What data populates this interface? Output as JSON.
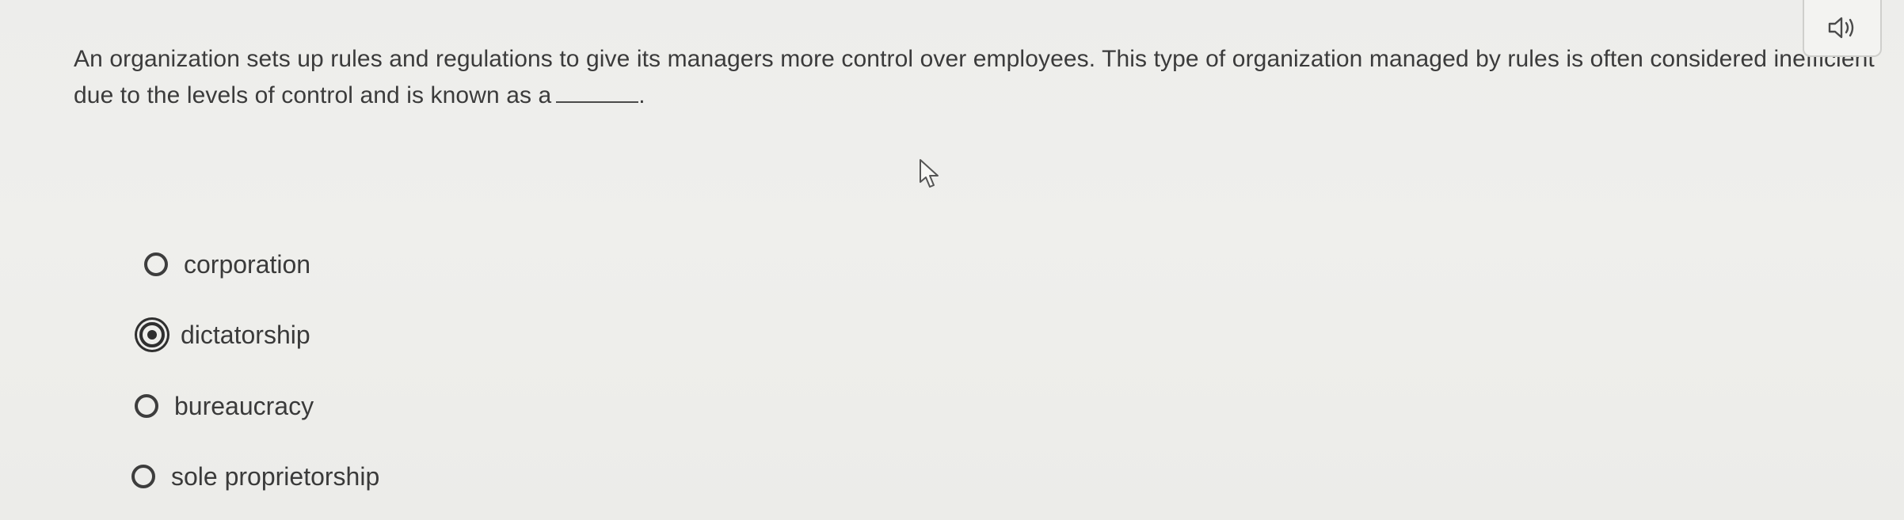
{
  "question": {
    "text": "An organization sets up rules and regulations to give its managers more control over employees. This type of organization managed by rules is often considered inefficient due to the levels of control and is known as a",
    "end_punctuation": "."
  },
  "audio": {
    "icon": "speaker-icon"
  },
  "options": [
    {
      "label": "corporation",
      "selected": false
    },
    {
      "label": "dictatorship",
      "selected": true
    },
    {
      "label": "bureaucracy",
      "selected": false
    },
    {
      "label": "sole proprietorship",
      "selected": false
    }
  ],
  "colors": {
    "background": "#ededeb",
    "text": "#3a3a3a",
    "radio": "#2f2f2f"
  }
}
